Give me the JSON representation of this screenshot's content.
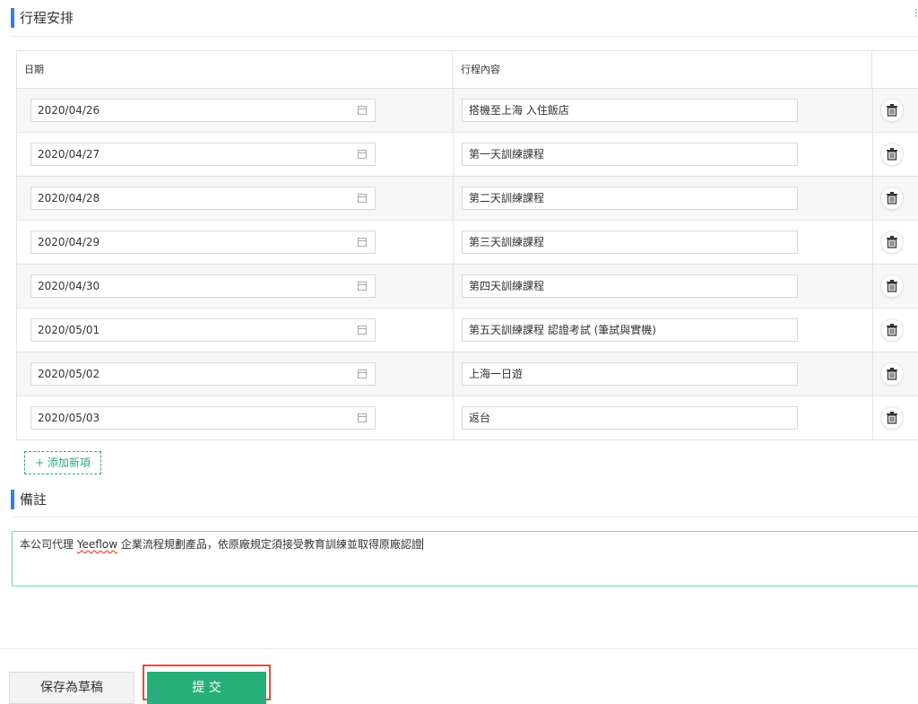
{
  "itinerary": {
    "title": "行程安排",
    "top_right_glyph": "⁝",
    "columns": {
      "date": "日期",
      "content": "行程內容"
    },
    "rows": [
      {
        "date": "2020/04/26",
        "content": "搭機至上海 入住飯店"
      },
      {
        "date": "2020/04/27",
        "content": "第一天訓練課程"
      },
      {
        "date": "2020/04/28",
        "content": "第二天訓練課程"
      },
      {
        "date": "2020/04/29",
        "content": "第三天訓練課程"
      },
      {
        "date": "2020/04/30",
        "content": "第四天訓練課程"
      },
      {
        "date": "2020/05/01",
        "content": "第五天訓練課程 認證考試 (筆試與實機)"
      },
      {
        "date": "2020/05/02",
        "content": "上海一日遊"
      },
      {
        "date": "2020/05/03",
        "content": "返台"
      }
    ],
    "add_label": "+ 添加新項"
  },
  "remarks": {
    "title": "備註",
    "text_before": "本公司代理 ",
    "brand": "Yeeflow",
    "text_after": " 企業流程規劃產品，依原廠規定須接受教育訓練並取得原廠認證"
  },
  "footer": {
    "draft_label": "保存為草稿",
    "submit_label": "提 交"
  },
  "colors": {
    "accent_blue": "#2f80ed",
    "accent_green": "#27ae7a",
    "highlight_red": "#e74c3c"
  },
  "icons": {
    "date": "calendar-icon",
    "delete": "trash-icon"
  }
}
